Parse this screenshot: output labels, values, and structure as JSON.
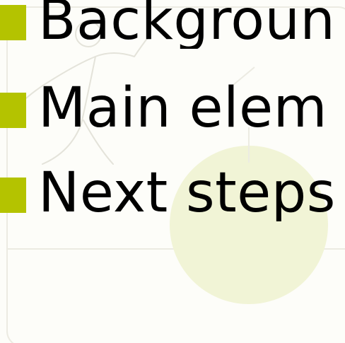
{
  "slide": {
    "bullets": [
      {
        "label": "Backgroun"
      },
      {
        "label": "Main elem"
      },
      {
        "label": "Next steps"
      }
    ]
  },
  "colors": {
    "bullet_marker": "#b4c300",
    "text": "#000000",
    "background": "#fdfdf9",
    "circle_tint": "#f1f4d6"
  },
  "icons": {
    "bullet": "square-bullet-icon",
    "background_figure": "person-outline-illustration"
  }
}
